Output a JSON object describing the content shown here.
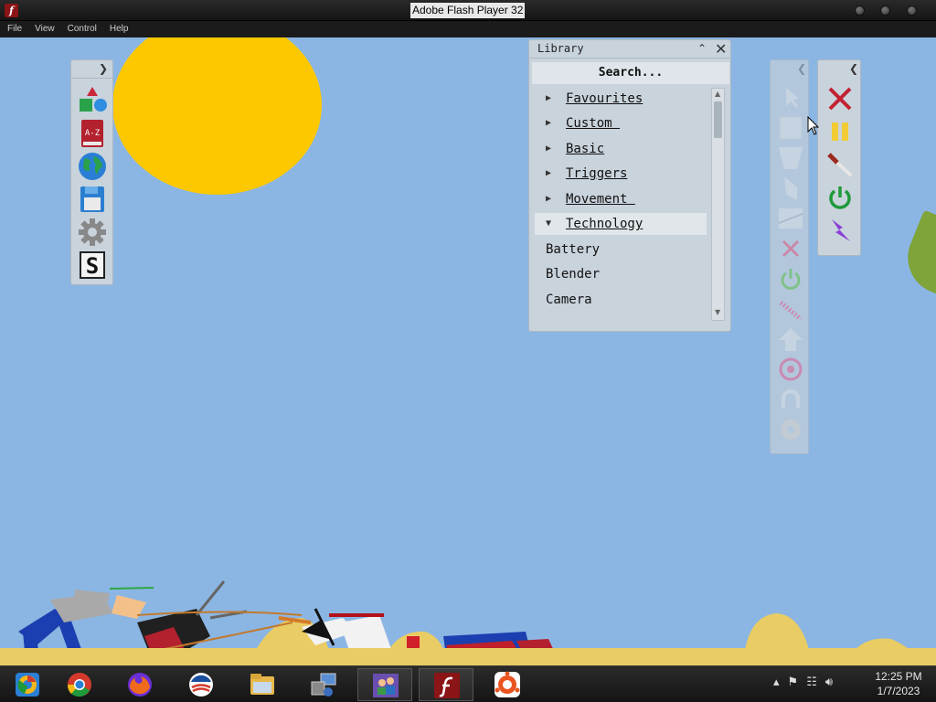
{
  "window": {
    "title": "Adobe Flash Player 32"
  },
  "menu": [
    "File",
    "View",
    "Control",
    "Help"
  ],
  "library": {
    "title": "Library",
    "search": "Search...",
    "categories": [
      "Favourites",
      "Custom ",
      "Basic",
      "Triggers",
      "Movement ",
      "Technology"
    ],
    "items": [
      "Battery",
      "Blender",
      "Camera"
    ]
  },
  "left_toolbar": {
    "icons": [
      "shapes-icon",
      "dictionary-icon",
      "globe-icon",
      "save-icon",
      "settings-icon",
      "s-logo-icon"
    ],
    "dictionary_text": "A-Z",
    "logo_text": "S"
  },
  "tools_faded": [
    "pointer-icon",
    "box-icon",
    "trapezoid-icon",
    "shield-shape-icon",
    "ramp-icon",
    "close-icon",
    "power-icon",
    "spring-icon",
    "arrow-up-icon",
    "target-icon",
    "magnet-icon",
    "gear-icon"
  ],
  "tools_active": [
    "delete-icon",
    "pause-icon",
    "knife-icon",
    "power-icon",
    "lightning-icon"
  ],
  "taskbar": {
    "apps": [
      "chrome-canary",
      "chrome",
      "firefox",
      "obama-browser",
      "file-explorer",
      "network-tool",
      "users-tool",
      "flash-player",
      "settings-app"
    ]
  },
  "clock": {
    "time": "12:25 PM",
    "date": "1/7/2023"
  },
  "colors": {
    "sky": "#8bb6e3",
    "sun": "#fdc800",
    "ground": "#e9cc64",
    "panel": "#c9d3dc"
  }
}
